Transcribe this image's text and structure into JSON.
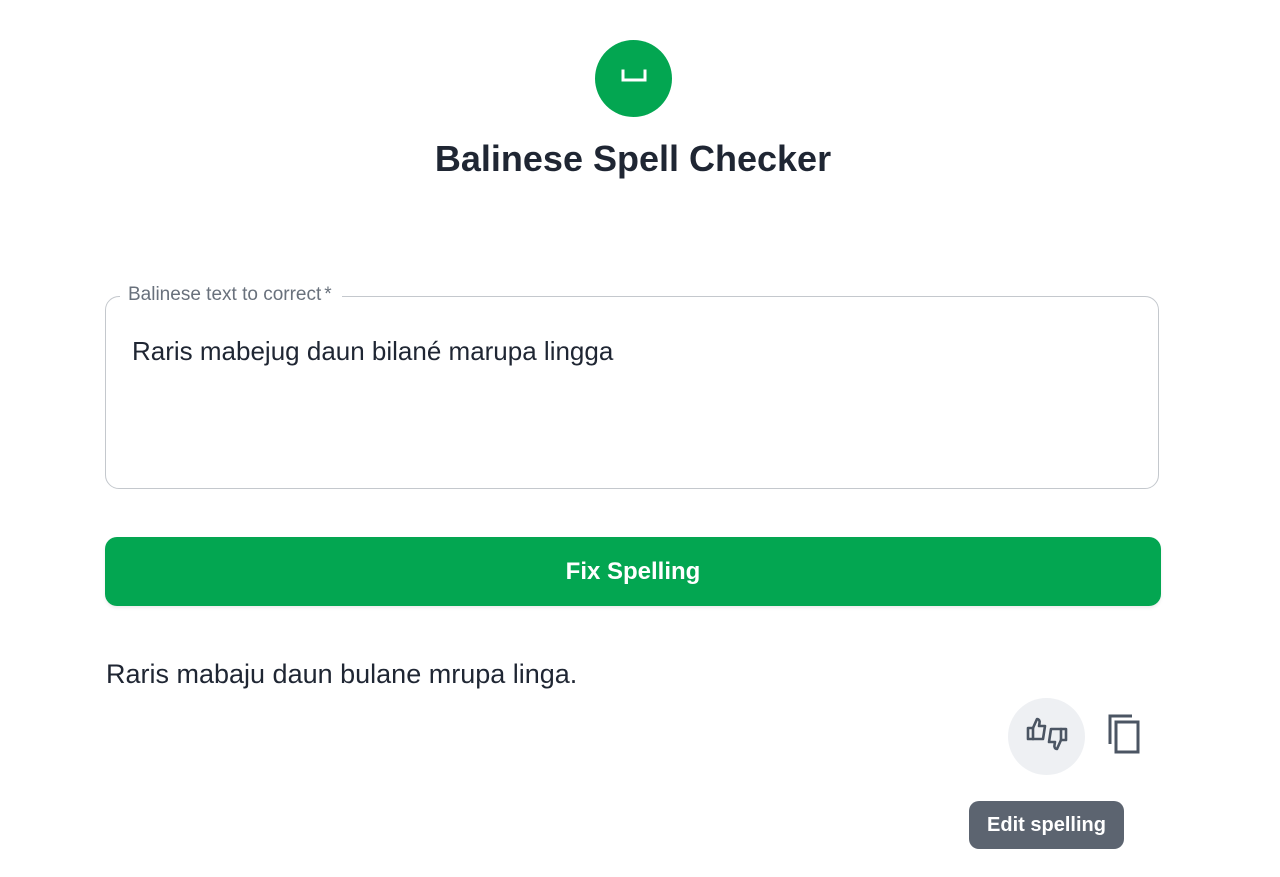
{
  "header": {
    "logo_icon": "space-bar-icon",
    "title": "Balinese Spell Checker"
  },
  "form": {
    "input_label": "Balinese text to correct",
    "required_marker": "*",
    "input_value": "Raris mabejug daun bilané marupa lingga",
    "submit_label": "Fix Spelling"
  },
  "result": {
    "text": "Raris mabaju daun bulane mrupa linga.",
    "edit_icon": "thumbs-up-down-icon",
    "copy_icon": "copy-icon",
    "tooltip": "Edit spelling"
  },
  "colors": {
    "accent": "#03a651",
    "text": "#1f2633",
    "muted": "#69717c",
    "tooltip_bg": "#5c6470"
  }
}
